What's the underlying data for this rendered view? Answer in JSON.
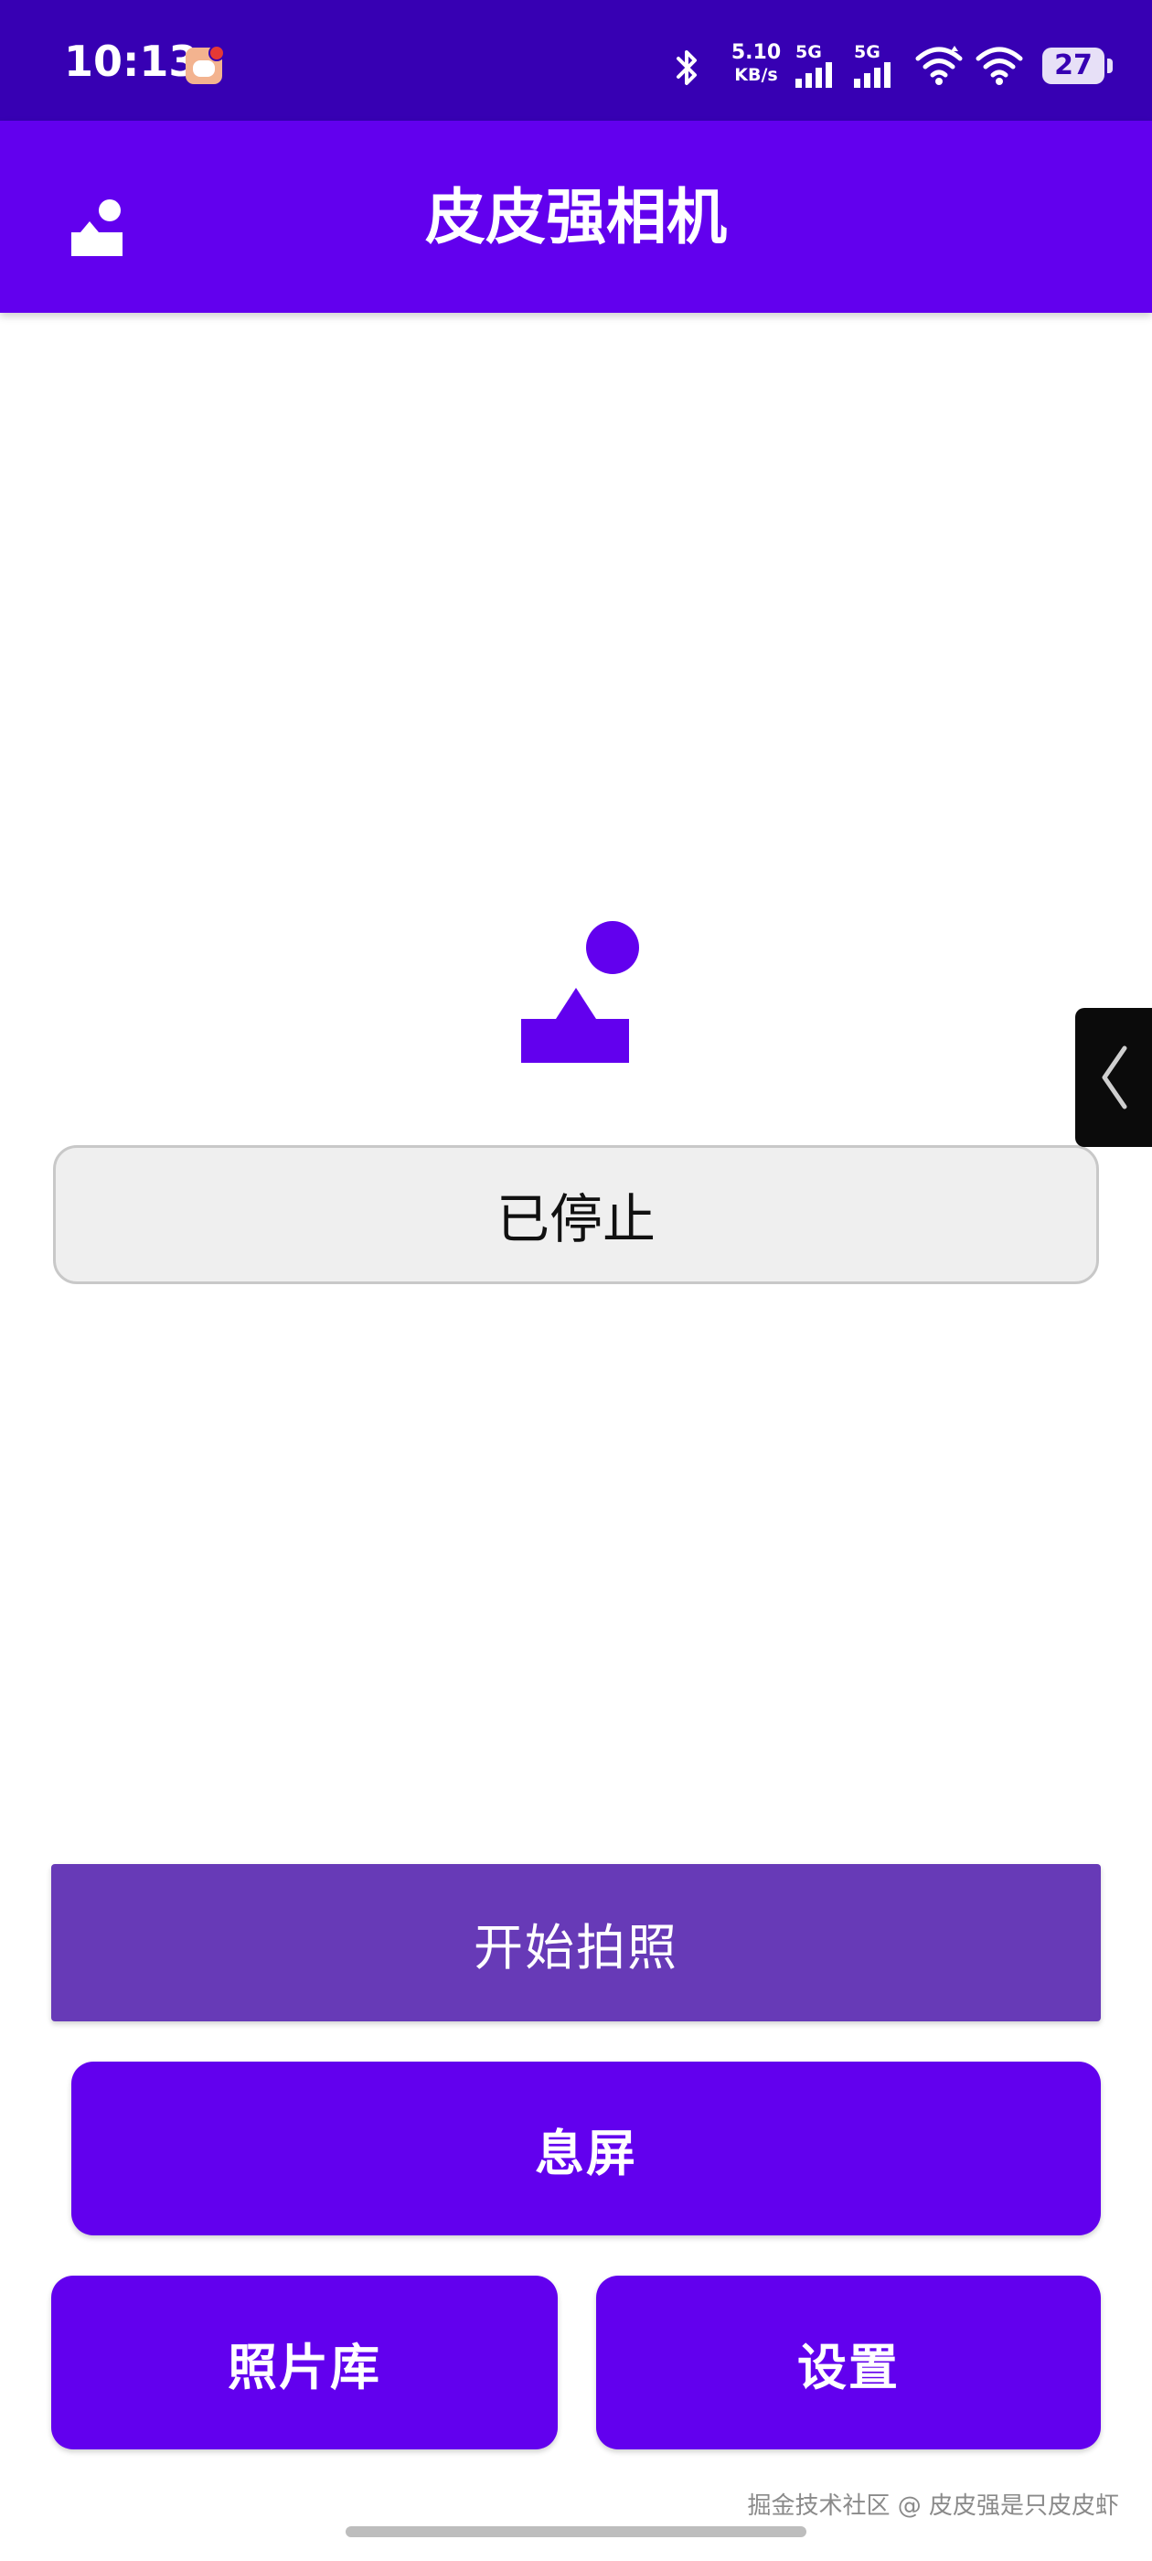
{
  "status_bar": {
    "time": "10:13",
    "net_speed_value": "5.10",
    "net_speed_unit": "KB/s",
    "signal1_label": "5G",
    "signal2_label": "5G",
    "battery": "27",
    "icons": [
      "app-notification-icon",
      "bluetooth-icon",
      "signal-icon",
      "signal-icon",
      "wifi-icon",
      "wifi-icon",
      "battery-icon"
    ]
  },
  "app_bar": {
    "title": "皮皮强相机",
    "icon": "camera-logo-icon"
  },
  "main": {
    "hero_icon": "camera-logo-icon",
    "status_text": "已停止"
  },
  "buttons": {
    "start": "开始拍照",
    "screen_off": "息屏",
    "gallery": "照片库",
    "settings": "设置"
  },
  "side_handle": {
    "icon": "chevron-left-icon"
  },
  "watermark": "掘金技术社区 @ 皮皮强是只皮皮虾",
  "colors": {
    "status_bar": "#3700B3",
    "primary": "#6200EE",
    "start_button": "#673AB7",
    "status_box_bg": "#EFEFEF"
  }
}
